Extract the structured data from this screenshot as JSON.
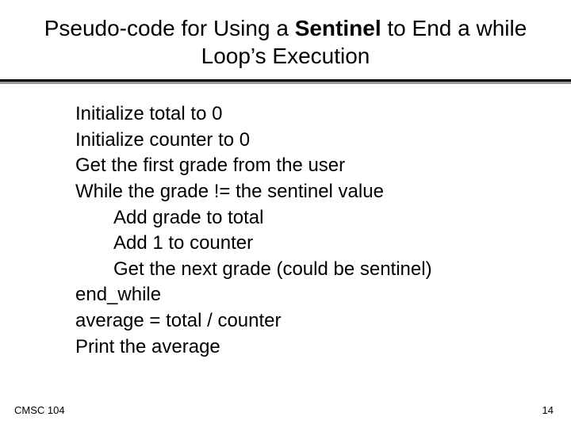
{
  "title": {
    "part1": "Pseudo-code for Using a ",
    "bold": "Sentinel",
    "part2": " to End a while Loop’s Execution"
  },
  "lines": [
    {
      "text": "Initialize total to 0",
      "indent": 1
    },
    {
      "text": "Initialize counter to 0",
      "indent": 1
    },
    {
      "text": "Get the first grade from the user",
      "indent": 1
    },
    {
      "text": "While the grade != the sentinel value",
      "indent": 1
    },
    {
      "text": "Add grade to total",
      "indent": 2
    },
    {
      "text": "Add 1 to counter",
      "indent": 2
    },
    {
      "text": "Get the next grade (could be sentinel)",
      "indent": 2
    },
    {
      "text": "end_while",
      "indent": 1
    },
    {
      "text": "average = total / counter",
      "indent": 1
    },
    {
      "text": "Print the average",
      "indent": 1
    }
  ],
  "footer": {
    "course": "CMSC 104",
    "page": "14"
  }
}
